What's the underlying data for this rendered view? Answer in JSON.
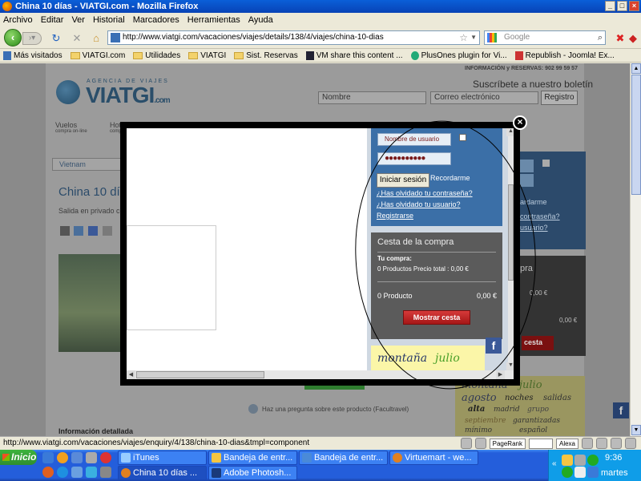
{
  "window": {
    "title": "China 10 días - VIATGI.com - Mozilla Firefox"
  },
  "menu": [
    "Archivo",
    "Editar",
    "Ver",
    "Historial",
    "Marcadores",
    "Herramientas",
    "Ayuda"
  ],
  "nav": {
    "url": "http://www.viatgi.com/vacaciones/viajes/details/138/4/viajes/china-10-dias",
    "search_placeholder": "Google"
  },
  "bookmarks": [
    {
      "label": "Más visitados",
      "icon": "page-icon"
    },
    {
      "label": "VIATGI.com",
      "icon": "folder-icon"
    },
    {
      "label": "Utilidades",
      "icon": "folder-icon"
    },
    {
      "label": "VIATGI",
      "icon": "folder-icon"
    },
    {
      "label": "Sist. Reservas",
      "icon": "folder-icon"
    },
    {
      "label": "VM share this content ...",
      "icon": "page-icon"
    },
    {
      "label": "PlusOnes plugin for Vi...",
      "icon": "page-icon"
    },
    {
      "label": "Republish - Joomla! Ex...",
      "icon": "page-icon"
    }
  ],
  "site": {
    "logo_small": "AGENCIA DE VIAJES",
    "logo": "VIATGI",
    "logo_suffix": ".com",
    "info_phone": "INFORMACIÓN y RESERVAS: 902 99 59 57",
    "newsletter_title": "Suscríbete a nuestro boletín",
    "newsletter_name_placeholder": "Nombre",
    "newsletter_email_placeholder": "Correo electrónico",
    "newsletter_button": "Registro",
    "nav_item_1": "Vuelos",
    "nav_item_1_sub": "compra on-line",
    "nav_item_2": "Hot",
    "nav_item_2_sub": "comp",
    "breadcrumb": "Vietnam",
    "page_title": "China 10 día",
    "subtitle": "Salida en privado co",
    "question_link": "Haz una pregunta sobre este producto (Facultravel)",
    "detail_heading": "Información detallada"
  },
  "modal": {
    "username_placeholder": "Nombre de usuario",
    "password_value": "●●●●●●●●●●",
    "login_button": "Iniciar sesión",
    "remember_label": "Recordarme",
    "forgot_password": "¿Has olvidado tu contraseña?",
    "forgot_user": "¿Has olvidado tu usuario?",
    "register": "Registrarse",
    "cart_title": "Cesta de la compra",
    "cart_your_purchase": "Tu compra:",
    "cart_summary": "0 Productos Precio total : 0,00 €",
    "cart_count": "0 Producto",
    "cart_total": "0,00 €",
    "cart_button": "Mostrar cesta",
    "tag_1": "montaña",
    "tag_2": "julio"
  },
  "background_right": {
    "forgot_password_partial": "contraseña?",
    "forgot_user_partial": "usuario?",
    "remember_partial": "ardarme",
    "cart_partial_title": "pra",
    "cart_partial_total": "0,00 €",
    "cart_partial_amount": "0,00 €",
    "cart_partial_button": "cesta",
    "tags": [
      "montaña",
      "julio",
      "agosto",
      "noches",
      "salidas",
      "alta",
      "madrid",
      "grupo",
      "septiembre",
      "garantizadas",
      "mínimo",
      "español"
    ]
  },
  "statusbar": {
    "text": "http://www.viatgi.com/vacaciones/viajes/enquiry/4/138/china-10-dias&tmpl=component",
    "pagerank": "PageRank",
    "alexa": "Alexa"
  },
  "taskbar": {
    "start": "Inicio",
    "tasks_top": [
      "iTunes",
      "Bandeja de entr...",
      "Bandeja de entr...",
      "Virtuemart - we..."
    ],
    "tasks_bottom": [
      "China 10 días ...",
      "Adobe Photosh..."
    ],
    "clock": "9:36",
    "day": "martes"
  },
  "colors": {
    "login_panel": "#3b6fa7",
    "cart_panel": "#5b5b5b",
    "cart_button": "#c62020",
    "tag_cloud": "#fbf6a8"
  }
}
